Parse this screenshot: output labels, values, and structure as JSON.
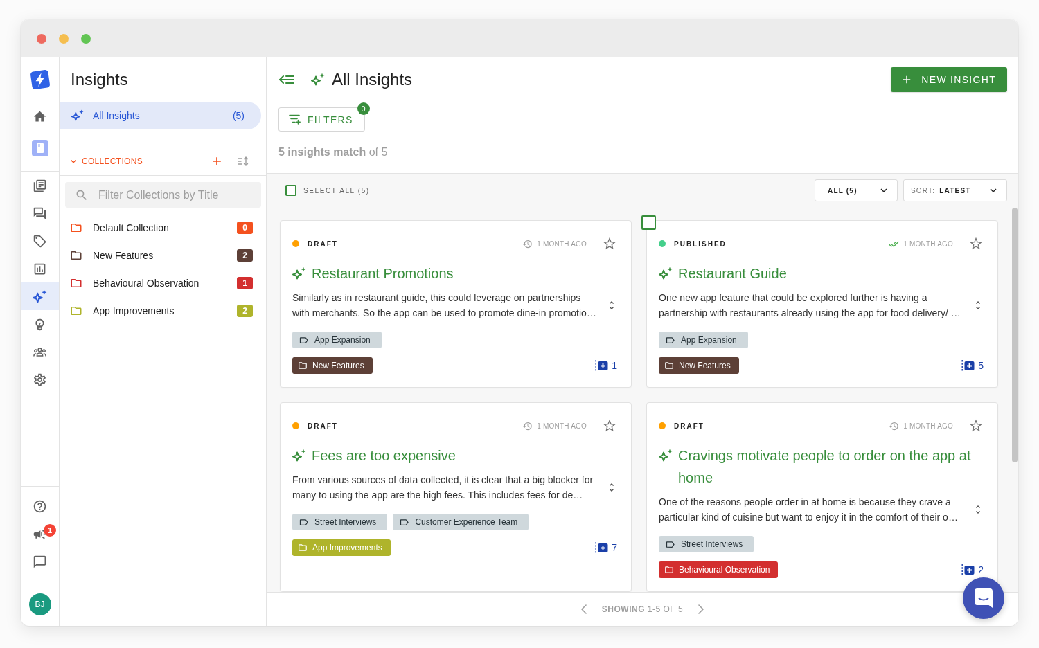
{
  "rail": {
    "top": [
      {
        "kind": "home",
        "selected": false
      },
      {
        "kind": "notebook",
        "selected": false
      }
    ],
    "main": [
      {
        "kind": "documents",
        "selected": false
      },
      {
        "kind": "discussions",
        "selected": false
      },
      {
        "kind": "tags",
        "selected": false
      },
      {
        "kind": "reports",
        "selected": false
      },
      {
        "kind": "insights",
        "selected": true
      },
      {
        "kind": "ideas",
        "selected": false
      },
      {
        "kind": "people",
        "selected": false
      },
      {
        "kind": "settings",
        "selected": false
      }
    ],
    "bottom": [
      {
        "kind": "help"
      },
      {
        "kind": "announcements",
        "badge": "1"
      },
      {
        "kind": "feedback"
      }
    ],
    "avatar": "BJ"
  },
  "sidebar": {
    "title": "Insights",
    "nav": [
      {
        "label": "All Insights",
        "count": "(5)",
        "selected": true
      }
    ],
    "collections": {
      "label": "COLLECTIONS",
      "expanded": true,
      "search": {
        "placeholder": "Filter Collections by Title"
      },
      "items": [
        {
          "name": "Default Collection",
          "count": "0",
          "color": "#f4511e"
        },
        {
          "name": "New Features",
          "count": "2",
          "color": "#5d4037"
        },
        {
          "name": "Behavioural Observation",
          "count": "1",
          "color": "#d32f2f"
        },
        {
          "name": "App Improvements",
          "count": "2",
          "color": "#afb42b"
        }
      ]
    }
  },
  "main": {
    "title": "All Insights",
    "new_button": "NEW INSIGHT",
    "filters": {
      "label": "FILTERS",
      "badge": "0"
    },
    "summary": "**5 insights match** of 5",
    "toolbar": {
      "select_all": {
        "label": "SELECT ALL (5)",
        "checked": false
      },
      "scope": "ALL (5)",
      "sort": {
        "label": "SORT:",
        "value": "LATEST"
      }
    },
    "cards": [
      {
        "status": {
          "kind": "draft",
          "label": "DRAFT",
          "color": "#ffa000"
        },
        "time": "1 MONTH AGO",
        "starred": false,
        "hovered": false,
        "selected": false,
        "title": "Restaurant Promotions",
        "description": "Similarly as in restaurant guide, this could leverage on partnerships with merchants. So the app can be used to promote dine-in promotio…",
        "tags": [
          "App Expansion"
        ],
        "collection": {
          "name": "New Features",
          "color": "#5d4037"
        },
        "count": "1"
      },
      {
        "status": {
          "kind": "published",
          "label": "PUBLISHED",
          "color": "#44cf8b"
        },
        "time": "1 MONTH AGO",
        "starred": false,
        "hovered": true,
        "selected": false,
        "title": "Restaurant Guide",
        "description": "One new app feature that could be explored further is having a partnership with restaurants already using the app for food delivery/ …",
        "tags": [
          "App Expansion"
        ],
        "collection": {
          "name": "New Features",
          "color": "#5d4037"
        },
        "count": "5"
      },
      {
        "status": {
          "kind": "draft",
          "label": "DRAFT",
          "color": "#ffa000"
        },
        "time": "1 MONTH AGO",
        "starred": false,
        "hovered": false,
        "selected": false,
        "title": "Fees are too expensive",
        "description": "From various sources of data collected, it is clear that a big blocker for many to using the app are the high fees. This includes fees for de…",
        "tags": [
          "Street Interviews",
          "Customer Experience Team"
        ],
        "collection": {
          "name": "App Improvements",
          "color": "#afb42b"
        },
        "count": "7"
      },
      {
        "status": {
          "kind": "draft",
          "label": "DRAFT",
          "color": "#ffa000"
        },
        "time": "1 MONTH AGO",
        "starred": false,
        "hovered": false,
        "selected": false,
        "title": "Cravings motivate people to order on the app at home",
        "description": "One of the reasons people order in at home is because they crave a particular kind of cuisine but want to enjoy it in the comfort of their o…",
        "tags": [
          "Street Interviews"
        ],
        "collection": {
          "name": "Behavioural Observation",
          "color": "#d32f2f"
        },
        "count": "2"
      }
    ],
    "pagination": "**SHOWING 1-5** OF 5"
  }
}
